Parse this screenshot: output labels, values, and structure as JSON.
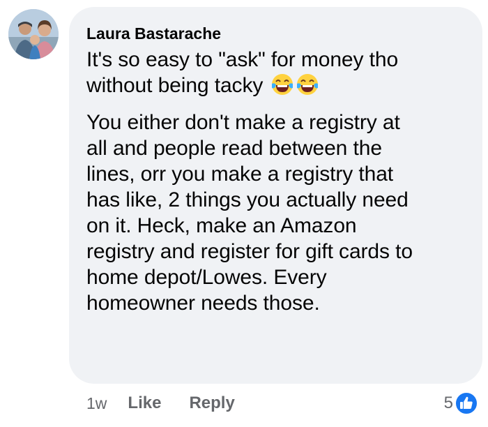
{
  "comment": {
    "author": "Laura Bastarache",
    "paragraphs": [
      {
        "lines": [
          "It's so easy to \"ask\" for money tho",
          "without being tacky"
        ],
        "trailing_emojis": [
          "face-with-tears-of-joy-icon",
          "face-with-tears-of-joy-icon"
        ]
      },
      {
        "lines": [
          "You either don't make a registry at",
          "all and people read between the",
          "lines, orr you make a registry that",
          "has like, 2 things you actually need",
          "on it. Heck, make an Amazon",
          "registry and register for gift cards to",
          "home depot/Lowes. Every",
          "homeowner needs those."
        ]
      }
    ]
  },
  "actions": {
    "timestamp": "1w",
    "like_label": "Like",
    "reply_label": "Reply"
  },
  "reactions": {
    "count": "5",
    "icon": "like-thumbs-up-icon"
  },
  "colors": {
    "bubble_bg": "#f0f2f5",
    "secondary_text": "#65676b",
    "like_blue": "#1877f2"
  }
}
